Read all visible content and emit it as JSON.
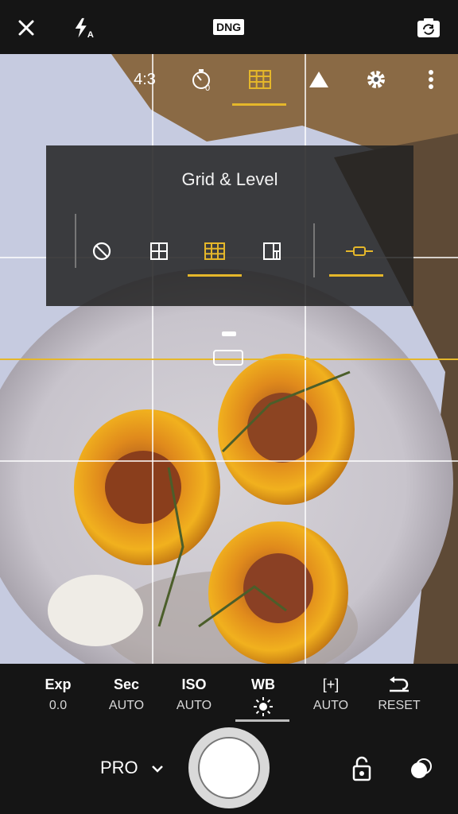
{
  "topbar": {
    "close_icon": "close-icon",
    "flash_icon": "flash-auto-icon",
    "format_badge": "DNG",
    "camera_switch_icon": "camera-switch-icon"
  },
  "overlay_toolbar": {
    "aspect_ratio": "4:3",
    "timer_value": "0",
    "selected": "grid",
    "colors": {
      "accent": "#e5b72a"
    }
  },
  "grid_panel": {
    "title": "Grid & Level",
    "options": [
      "none-icon",
      "grid-2x2-icon",
      "grid-3x3-icon",
      "golden-ratio-icon",
      "level-icon"
    ],
    "selected_grid": "grid-3x3-icon",
    "level_selected": true
  },
  "bottom_controls": {
    "items": [
      {
        "label": "Exp",
        "value": "0.0"
      },
      {
        "label": "Sec",
        "value": "AUTO"
      },
      {
        "label": "ISO",
        "value": "AUTO"
      },
      {
        "label": "WB",
        "value": ""
      },
      {
        "label": "[+]",
        "value": "AUTO"
      },
      {
        "label": "",
        "value": "RESET"
      }
    ],
    "selected": "WB"
  },
  "bottom_bar": {
    "mode": "PRO",
    "lock_icon": "unlock-settings-icon",
    "effects_icon": "effects-icon"
  }
}
